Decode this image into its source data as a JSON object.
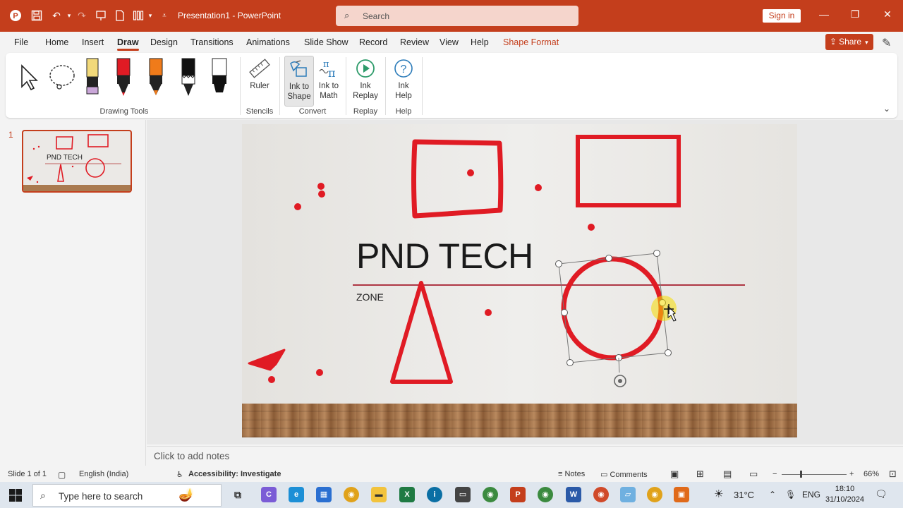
{
  "titlebar": {
    "doc_title": "Presentation1  -  PowerPoint",
    "search_placeholder": "Search",
    "signin_label": "Sign in",
    "bg_color": "#c43e1c"
  },
  "menu": {
    "tabs": [
      "File",
      "Home",
      "Insert",
      "Draw",
      "Design",
      "Transitions",
      "Animations",
      "Slide Show",
      "Record",
      "Review",
      "View",
      "Help",
      "Shape Format"
    ],
    "active_tab": "Draw",
    "share_label": "Share"
  },
  "ribbon": {
    "groups": {
      "drawing_tools": "Drawing Tools",
      "stencils": "Stencils",
      "convert": "Convert",
      "replay": "Replay",
      "help": "Help"
    },
    "buttons": {
      "ruler": "Ruler",
      "ink_to_shape_1": "Ink to",
      "ink_to_shape_2": "Shape",
      "ink_to_math_1": "Ink to",
      "ink_to_math_2": "Math",
      "ink_replay_1": "Ink",
      "ink_replay_2": "Replay",
      "ink_help_1": "Ink",
      "ink_help_2": "Help"
    },
    "pens": [
      {
        "name": "highlighter-yellow",
        "color": "#f2d97a"
      },
      {
        "name": "pen-red",
        "color": "#e01b24"
      },
      {
        "name": "pencil-orange",
        "color": "#f07b1a"
      },
      {
        "name": "pen-black",
        "color": "#111111"
      },
      {
        "name": "highlighter-black",
        "color": "#111111"
      }
    ]
  },
  "slides_pane": {
    "slide_number": "1",
    "thumb_title": "PND TECH"
  },
  "slide": {
    "title": "PND TECH",
    "subtitle": "ZONE",
    "ink_color": "#e01b24"
  },
  "notes": {
    "placeholder": "Click to add notes"
  },
  "statusbar": {
    "slide_info": "Slide 1 of 1",
    "language": "English (India)",
    "accessibility": "Accessibility: Investigate",
    "notes": "Notes",
    "comments": "Comments",
    "zoom": "66%"
  },
  "taskbar": {
    "search_placeholder": "Type here to search",
    "temperature": "31°C",
    "lang": "ENG",
    "time": "18:10",
    "date": "31/10/2024"
  }
}
